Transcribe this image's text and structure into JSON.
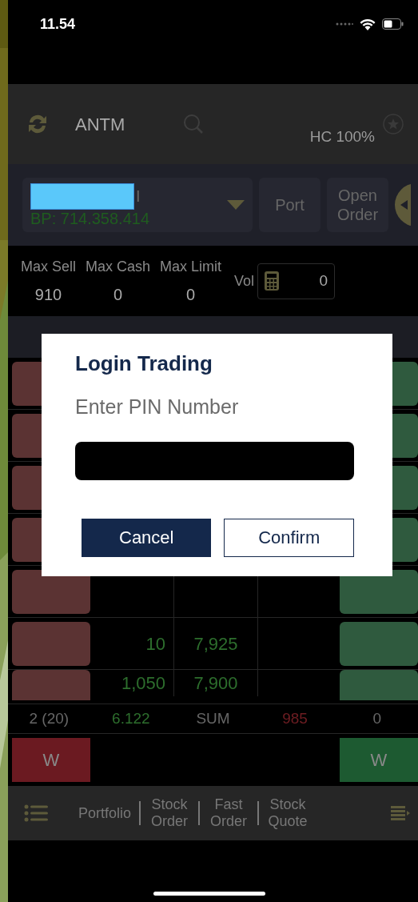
{
  "status_bar": {
    "time": "11.54"
  },
  "header": {
    "symbol": "ANTM",
    "haircut": "HC 100%"
  },
  "account": {
    "name_tail": "I",
    "buying_power": "BP: 714.358.414",
    "buttons": [
      "Port",
      "Open Order"
    ]
  },
  "stats": [
    {
      "label": "Max Sell",
      "value": "910"
    },
    {
      "label": "Max Cash",
      "value": "0"
    },
    {
      "label": "Max Limit",
      "value": "0"
    }
  ],
  "volume": {
    "label": "Vol",
    "value": "0"
  },
  "order_book": {
    "rows": [
      {
        "bid_volume": "10",
        "price": "7,925"
      },
      {
        "bid_volume": "1,050",
        "price": "7,900"
      }
    ]
  },
  "summary": [
    {
      "text": "2 (20)",
      "color": "#666666"
    },
    {
      "text": "6.122",
      "color": "#2d6e2d"
    },
    {
      "text": "SUM",
      "color": "#666666"
    },
    {
      "text": "985",
      "color": "#6e1d22"
    },
    {
      "text": "0",
      "color": "#666666"
    }
  ],
  "quick_buttons": [
    {
      "label": "W",
      "color": "#6b1a21"
    },
    {
      "label": "W",
      "color": "#1d5a31"
    }
  ],
  "bottom_nav": [
    {
      "label": "Portfolio"
    },
    {
      "label": "Stock Order"
    },
    {
      "label": "Fast Order"
    },
    {
      "label": "Stock Quote"
    }
  ],
  "dialog": {
    "title": "Login Trading",
    "prompt": "Enter PIN Number",
    "buttons": [
      {
        "label": "Cancel",
        "primary": true
      },
      {
        "label": "Confirm",
        "primary": false
      }
    ]
  }
}
